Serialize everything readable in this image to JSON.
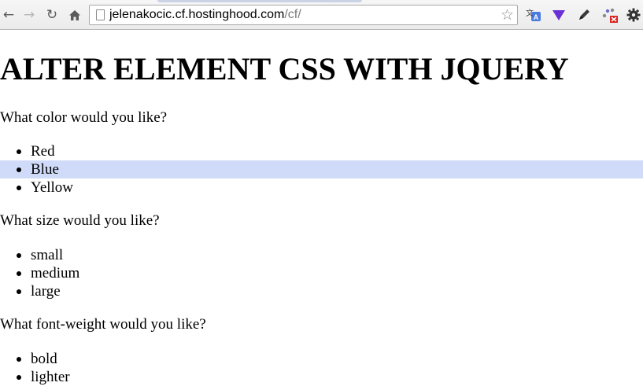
{
  "browser": {
    "url_host": "jelenakocic.cf.hostinghood.com",
    "url_path": "/cf/"
  },
  "page": {
    "title": "ALTER ELEMENT CSS WITH JQUERY",
    "sections": [
      {
        "question": "What color would you like?",
        "options": [
          "Red",
          "Blue",
          "Yellow"
        ],
        "highlighted": "Blue"
      },
      {
        "question": "What size would you like?",
        "options": [
          "small",
          "medium",
          "large"
        ]
      },
      {
        "question": "What font-weight would you like?",
        "options": [
          "bold",
          "lighter"
        ]
      }
    ]
  },
  "colors": {
    "highlight": "#cfdbf9",
    "extension_translate": "#4a7be0",
    "extension_vimeo": "#6a2fd6",
    "extension_error_badge": "#d8231f"
  }
}
